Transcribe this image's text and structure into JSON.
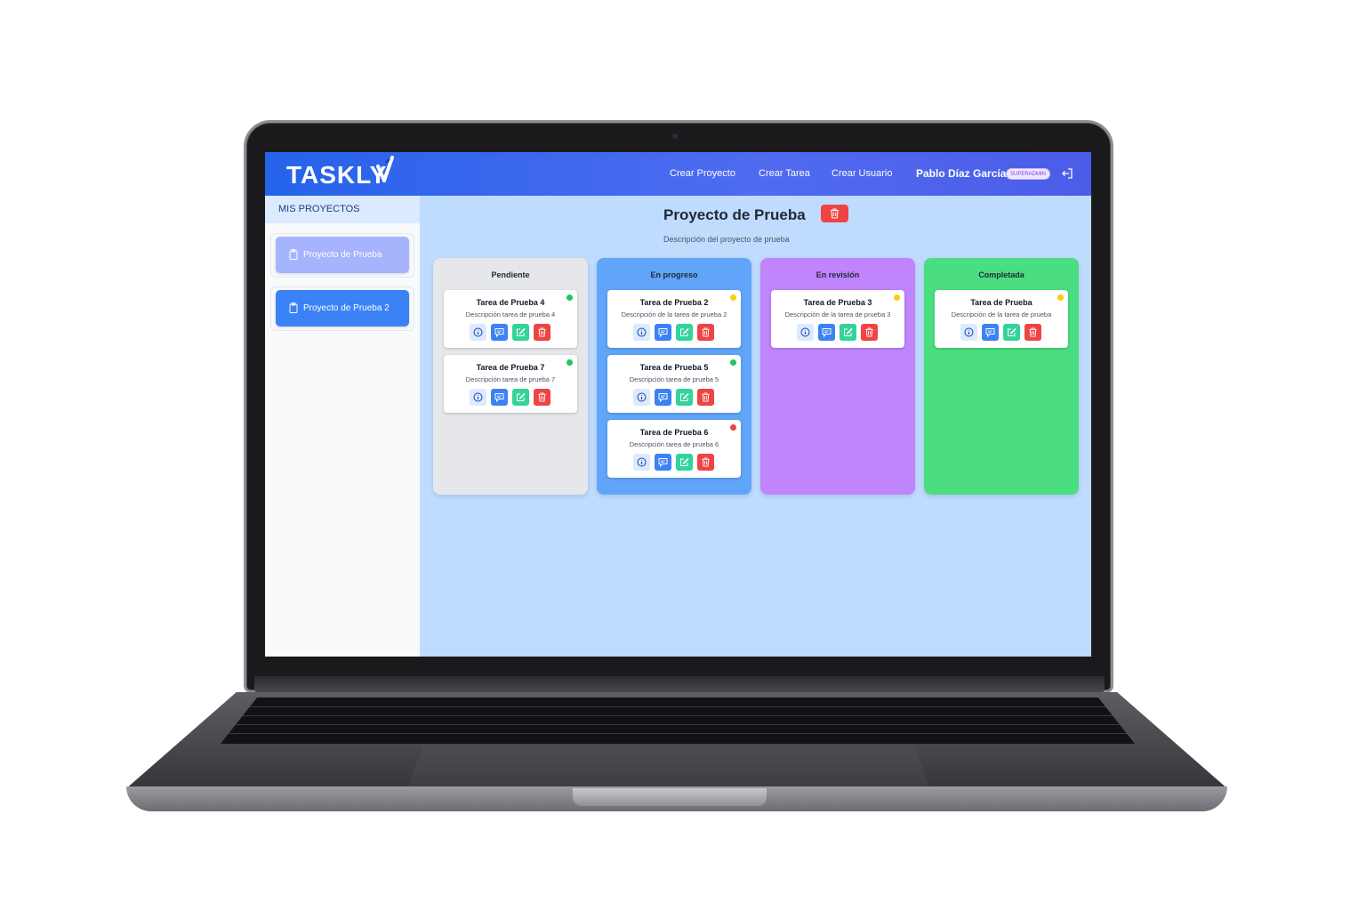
{
  "app": {
    "logo": "TASKLY",
    "nav": [
      "Crear Proyecto",
      "Crear Tarea",
      "Crear Usuario"
    ],
    "user": {
      "name": "Pablo Díaz García",
      "role": "SUPERADMIN"
    }
  },
  "sidebar": {
    "title": "MIS PROYECTOS",
    "projects": [
      "Proyecto de Prueba",
      "Proyecto de Prueba 2"
    ],
    "selected": 0
  },
  "project": {
    "title": "Proyecto de Prueba",
    "description": "Descripción del proyecto de prueba"
  },
  "colors": {
    "pendiente": "#e5e7eb",
    "en_progreso": "#60a5fa",
    "en_revision": "#c084fc",
    "completada": "#4ade80",
    "priority_low": "#22c55e",
    "priority_medium": "#facc15",
    "priority_high": "#ef4444"
  },
  "columns": [
    {
      "title": "Pendiente",
      "tasks": [
        {
          "title": "Tarea de Prueba 4",
          "description": "Descripción tarea de prueba 4",
          "priority": "low"
        },
        {
          "title": "Tarea de Prueba 7",
          "description": "Descripción tarea de prueba 7",
          "priority": "low"
        }
      ]
    },
    {
      "title": "En progreso",
      "tasks": [
        {
          "title": "Tarea de Prueba 2",
          "description": "Descripción de la tarea de prueba 2",
          "priority": "medium"
        },
        {
          "title": "Tarea de Prueba 5",
          "description": "Descripción tarea de prueba 5",
          "priority": "low"
        },
        {
          "title": "Tarea de Prueba 6",
          "description": "Descripción tarea de prueba 6",
          "priority": "high"
        }
      ]
    },
    {
      "title": "En revisión",
      "tasks": [
        {
          "title": "Tarea de Prueba 3",
          "description": "Descripción de la tarea de prueba 3",
          "priority": "medium"
        }
      ]
    },
    {
      "title": "Completada",
      "tasks": [
        {
          "title": "Tarea de Prueba",
          "description": "Descripción de la tarea de prueba",
          "priority": "medium"
        }
      ]
    }
  ],
  "icons": {
    "task_actions": [
      "info-icon",
      "comment-icon",
      "edit-icon",
      "trash-icon"
    ],
    "project_delete": "trash-icon",
    "logout": "logout-icon",
    "project_item": "clipboard-icon"
  }
}
